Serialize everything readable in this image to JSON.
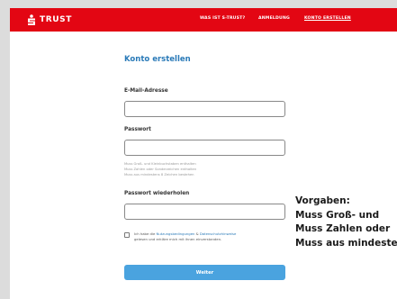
{
  "header": {
    "brand": "TRUST",
    "nav": [
      "WAS IST S-TRUST?",
      "ANMELDUNG",
      "KONTO ERSTELLEN"
    ]
  },
  "form": {
    "title": "Konto erstellen",
    "email_label": "E-Mail-Adresse",
    "password_label": "Passwort",
    "password_hints": [
      "Muss Groß- und Kleinbuchstaben enthalten",
      "Muss Zahlen oder Sonderzeichen enthalten",
      "Muss aus mindestens 8 Zeichen bestehen"
    ],
    "repeat_label": "Passwort wiederholen",
    "consent_prefix": "Ich habe die ",
    "consent_link1": "Nutzungsbedingungen",
    "consent_and": " & ",
    "consent_link2": "Datenschutzhinweise",
    "consent_suffix": "gelesen und erkläre mich mit ihnen einverstanden.",
    "submit_label": "Weiter"
  },
  "overlay": {
    "lines": [
      "Vorgaben:",
      "Muss Groß- und",
      "Muss Zahlen oder",
      "Muss aus mindestens"
    ]
  },
  "colors": {
    "brand_red": "#e30613",
    "accent_blue": "#2a7ab8",
    "button_blue": "#4aa3df"
  }
}
